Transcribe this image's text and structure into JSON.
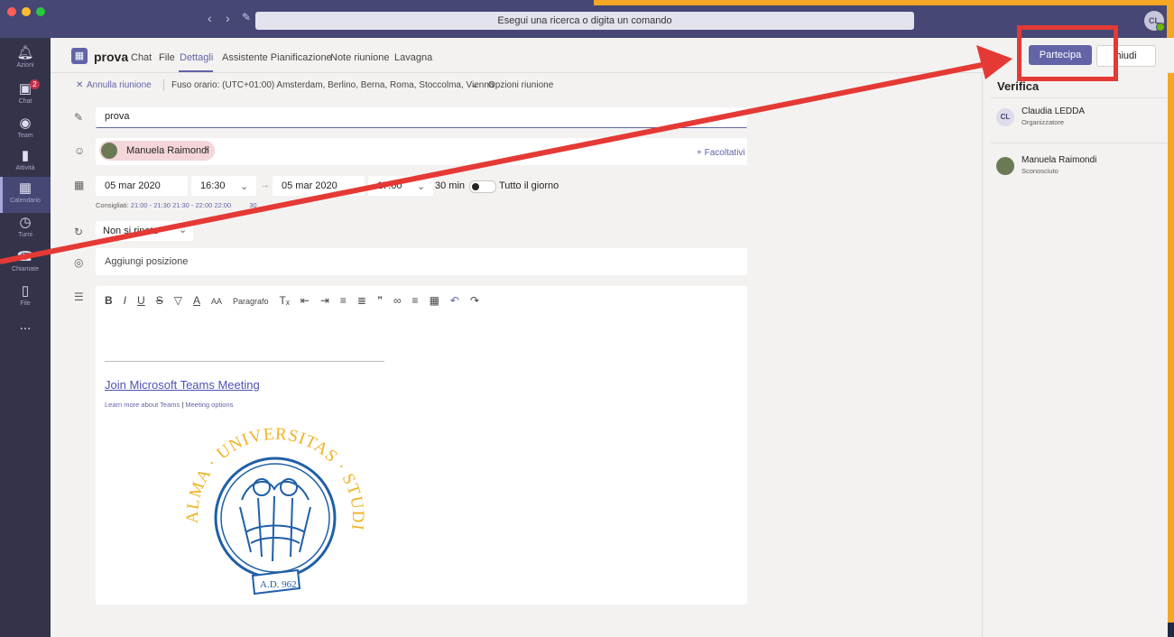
{
  "app": {
    "search_placeholder": "Esegui una ricerca o digita un comando",
    "user_initials": "CL"
  },
  "rail": {
    "items": [
      {
        "label": "Azioni",
        "icon": "bell-icon"
      },
      {
        "label": "Chat",
        "icon": "chat-icon",
        "badge": "2"
      },
      {
        "label": "Team",
        "icon": "team-icon"
      },
      {
        "label": "Attività",
        "icon": "activity-icon"
      },
      {
        "label": "Calendario",
        "icon": "calendar-icon"
      },
      {
        "label": "Turni",
        "icon": "shifts-icon"
      },
      {
        "label": "Chiamate",
        "icon": "calls-icon"
      },
      {
        "label": "File",
        "icon": "file-icon"
      },
      {
        "label": "...",
        "icon": "more-icon"
      }
    ]
  },
  "header": {
    "meeting_title": "prova",
    "tabs": [
      "Chat",
      "File",
      "Dettagli",
      "Assistente Pianificazione",
      "Note riunione",
      "Lavagna"
    ],
    "join_label": "Partecipa",
    "close_label": "hiudi"
  },
  "subbar": {
    "cancel": "Annulla riunione",
    "timezone": "Fuso orario: (UTC+01:00) Amsterdam, Berlino, Berna, Roma, Stoccolma, Vienna",
    "options": "Opzioni riunione"
  },
  "form": {
    "title_value": "prova",
    "attendee": "Manuela Raimondi",
    "optional": "+ Facoltativi",
    "start_date": "05 mar 2020",
    "start_time": "16:30",
    "end_date": "05 mar 2020",
    "end_time": "17:00",
    "duration": "30 min",
    "all_day": "Tutto il giorno",
    "suggested_label": "Consigliati:",
    "suggested_1": "21:00 - 21:30",
    "suggested_2": "21:30 - 22:00",
    "suggested_3": "22:00",
    "suggested_tail": "30",
    "recurrence": "Non si ripete",
    "location_placeholder": "Aggiungi posizione",
    "paragraph": "Paragrafo",
    "join_link": "Join Microsoft Teams Meeting",
    "learn_more": "Learn more about Teams",
    "meeting_options": "Meeting options"
  },
  "logo": {
    "top_text": "ALMA · UNIVERSITAS · STUDIORUM · PARMENSIS",
    "banner": "A.D. 962"
  },
  "panel": {
    "title": "Verifica",
    "people": [
      {
        "initials": "CL",
        "name": "Claudia LEDDA",
        "role": "Organizzatore"
      },
      {
        "name": "Manuela Raimondi",
        "role": "Sconosciuto"
      }
    ]
  },
  "colors": {
    "brand": "#6264a7",
    "rail": "#33344a",
    "titlebar": "#464775",
    "annotation": "#e53935",
    "logo_blue": "#1f5fa8",
    "logo_gold": "#f0b323"
  }
}
